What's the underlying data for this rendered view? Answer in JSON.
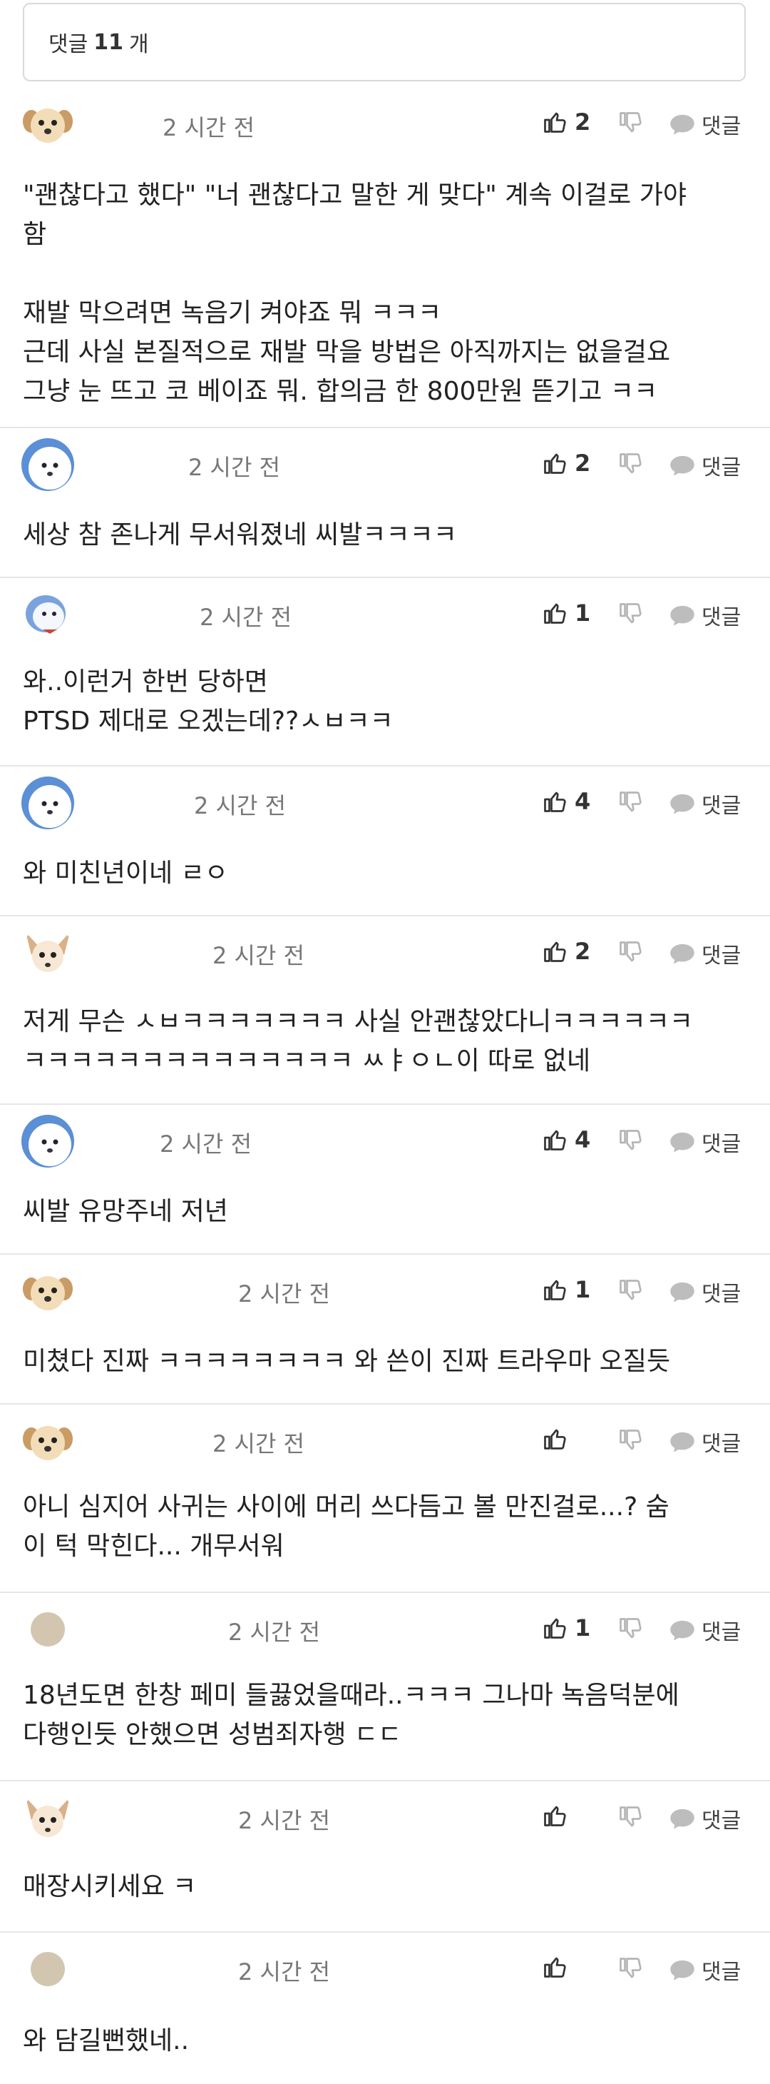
{
  "header": {
    "prefix": "댓글",
    "count": "11",
    "suffix": "개"
  },
  "reply_label": "댓글",
  "comments": [
    {
      "time": "2 시간 전",
      "likes": "2",
      "text": "\"괜찮다고 했다\" \"너 괜찮다고 말한 게 맞다\" 계속 이걸로 가야\n함\n\n재발 막으려면 녹음기 켜야죠 뭐 ㅋㅋㅋ\n근데 사실 본질적으로 재발 막을 방법은 아직까지는 없을걸요\n그냥 눈 뜨고 코 베이죠 뭐. 합의금 한 800만원 뜯기고 ㅋㅋ"
    },
    {
      "time": "2 시간 전",
      "likes": "2",
      "text": "세상 참 존나게 무서워졌네 씨발ㅋㅋㅋㅋ"
    },
    {
      "time": "2 시간 전",
      "likes": "1",
      "text": "와..이런거 한번 당하면\nPTSD 제대로 오겠는데??ㅅㅂㅋㅋ"
    },
    {
      "time": "2 시간 전",
      "likes": "4",
      "text": "와 미친년이네 ㄹㅇ"
    },
    {
      "time": "2 시간 전",
      "likes": "2",
      "text": "저게 무슨 ㅅㅂㅋㅋㅋㅋㅋㅋㅋ 사실 안괜찮았다니ㅋㅋㅋㅋㅋㅋ\nㅋㅋㅋㅋㅋㅋㅋㅋㅋㅋㅋㅋㅋㅋ ㅆㅑㅇㄴ이 따로 없네"
    },
    {
      "time": "2 시간 전",
      "likes": "4",
      "text": "씨발 유망주네 저년"
    },
    {
      "time": "2 시간 전",
      "likes": "1",
      "text": "미쳤다 진짜 ㅋㅋㅋㅋㅋㅋㅋㅋ 와 쓴이 진짜 트라우마 오질듯"
    },
    {
      "time": "2 시간 전",
      "likes": "",
      "text": "아니 심지어 사귀는 사이에 머리 쓰다듬고 볼 만진걸로...? 숨\n이 턱 막힌다... 개무서워"
    },
    {
      "time": "2 시간 전",
      "likes": "1",
      "text": "18년도면 한창 페미 들끓었을때라..ㅋㅋㅋ 그나마 녹음덕분에\n다행인듯 안했으면 성범죄자행 ㄷㄷ"
    },
    {
      "time": "2 시간 전",
      "likes": "",
      "text": "매장시키세요 ㅋ"
    },
    {
      "time": "2 시간 전",
      "likes": "",
      "text": "와 담길뻔했네.."
    }
  ]
}
